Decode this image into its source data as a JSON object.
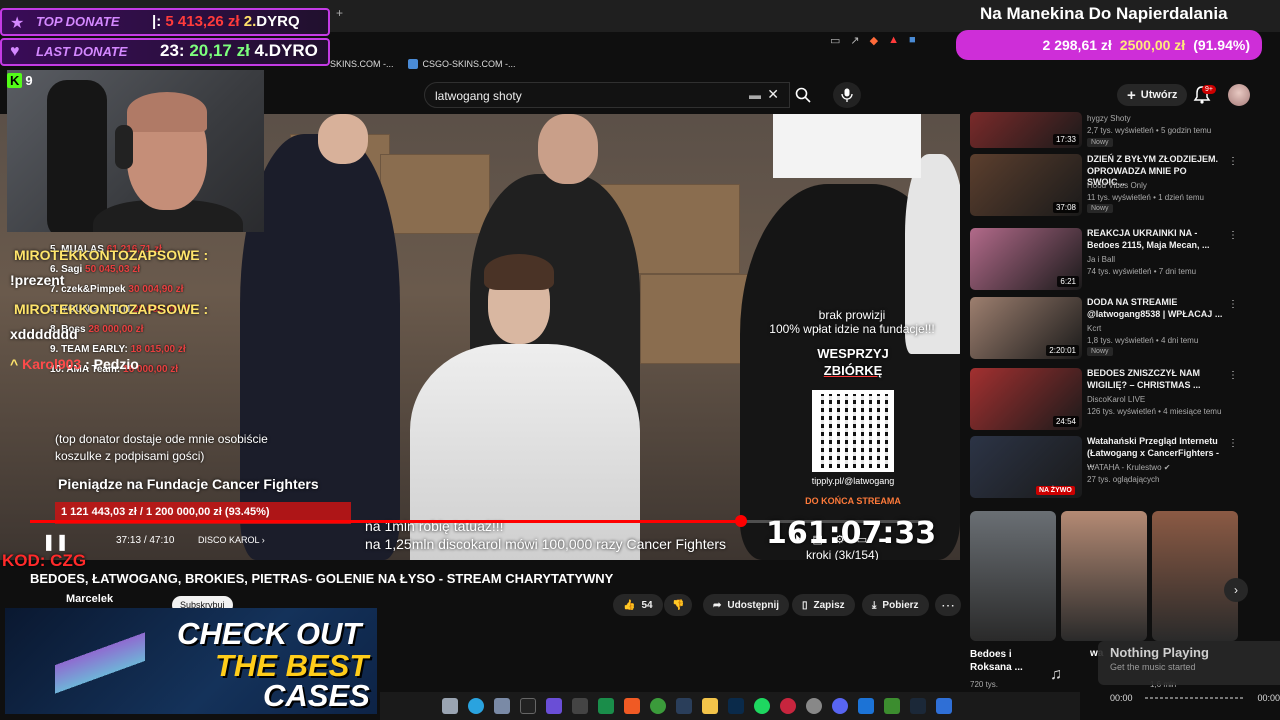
{
  "stream_overlay": {
    "top_donate_label": "TOP DONATE",
    "top_donate_amount": "5 413,26 zł",
    "top_donate_rank": "2.",
    "top_donate_name_prefix": "|:",
    "top_donate_name": "DYRQ",
    "last_donate_label": "LAST DONATE",
    "last_donate_prefix": "23:",
    "last_donate_amount": "20,17 zł",
    "last_donate_rank": "4.",
    "last_donate_name": "DYRO",
    "goal_title": "Na Manekina Do Napierdalania",
    "goal_current": "2 298,61 zł",
    "goal_target": "2500,00 zł",
    "goal_percent": "(91.94%)",
    "goal_fraction": 0.9194,
    "kick_icon": "K",
    "kick_viewers": "9",
    "chat": [
      {
        "user": "MIROTEKKONTOZAPSOWE :",
        "message": "!prezent"
      },
      {
        "user": "MIROTEKKONTOZAPSOWE :",
        "message": "xddddddd"
      },
      {
        "user": "Karol903",
        "message": ": Pedzio"
      }
    ],
    "promo_code": "KOD: CZG",
    "banner_line1": "CHECK OUT",
    "banner_line2": "THE BEST",
    "banner_line3": "CASES"
  },
  "browser": {
    "bookmarks": [
      "SKINS.COM -...",
      "CSGO-SKINS.COM -..."
    ]
  },
  "youtube": {
    "search_value": "latwogang shoty",
    "create_label": "Utwórz",
    "notifications_count": "9+",
    "video": {
      "overlay_fundraiser_1": "brak prowizji",
      "overlay_fundraiser_2": "100% wpłat idzie na fundacje!!!",
      "overlay_wesprzyj": "WESPRZYJ",
      "overlay_zbiorke": "ZBIÓRKĘ",
      "overlay_tipply": "tipply.pl/@latwogang",
      "overlay_do_konca": "DO KOŃCA STREAMA",
      "overlay_timer": "161:07:33",
      "overlay_kroki": "kroki (3k/154)",
      "overlay_1mln": "na 1mln robię tatuaż!!!",
      "overlay_125mln": "na 1,25mln discokarol mówi 100,000 razy Cancer Fighters",
      "overlay_donors": [
        {
          "rank": "5.",
          "name": "MUALAS",
          "amount": "61 216,71 zł"
        },
        {
          "rank": "6.",
          "name": "Sagi",
          "amount": "50 045,03 zł"
        },
        {
          "rank": "7.",
          "name": "czek&Pimpek",
          "amount": "30 004,90 zł"
        },
        {
          "rank": "8.",
          "name": "YOUNG MULTI",
          "amount": "28 035,00 zł"
        },
        {
          "rank": "8.",
          "name": "Boss",
          "amount": "28 000,00 zł"
        },
        {
          "rank": "9.",
          "name": "TEAM EARLY:",
          "amount": "18 015,00 zł"
        },
        {
          "rank": "10.",
          "name": "AMA Team:",
          "amount": "16 000,00 zł"
        }
      ],
      "overlay_note": "(top donator dostaje ode mnie osobiście koszulke z podpisami gości)",
      "overlay_fundacja": "Pieniądze na Fundacje Cancer Fighters",
      "overlay_redbar": "1 121 443,03 zł / 1 200 000,00 zł (93.45%)",
      "time_current": "37:13",
      "time_total": "47:10",
      "time_separator": "/",
      "progress_fraction": 0.79,
      "chapter": "DISCO KAROL",
      "title": "BEDOES, ŁATWOGANG, BROKIES, PIETRAS- GOLENIE NA ŁYSO - STREAM CHARYTATYWNY",
      "channel": "Marcelek",
      "subscribe_label": "Subskrybuj",
      "likes": "54",
      "share_label": "Udostępnij",
      "save_label": "Zapisz",
      "download_label": "Pobierz"
    },
    "recommendations": [
      {
        "title": "",
        "channel": "hygzy Shoty",
        "meta": "2,7 tys. wyświetleń • 5 godzin temu",
        "badge": "Nowy",
        "duration": "17:33",
        "thumb": "#7a2a2a"
      },
      {
        "title": "DZIEŃ Z BYŁYM ZŁODZIEJEM. OPROWADZA MNIE PO SWOIC...",
        "channel": "Hood Vibes Only",
        "meta": "11 tys. wyświetleń • 1 dzień temu",
        "badge": "Nowy",
        "duration": "37:08",
        "thumb": "#5c3f2e"
      },
      {
        "title": "REAKCJA UKRAINKI NA - Bedoes 2115, Maja Mecan, ...",
        "channel": "Ja i Ball",
        "meta": "74 tys. wyświetleń • 7 dni temu",
        "badge": "",
        "duration": "6:21",
        "thumb": "#b26a8a"
      },
      {
        "title": "DODA NA STREAMIE @latwogang8538 | WPŁACAJ ...",
        "channel": "Kcrt",
        "meta": "1,8 tys. wyświetleń • 4 dni temu",
        "badge": "Nowy",
        "duration": "2:20:01",
        "thumb": "#9d7f6f"
      },
      {
        "title": "BEDOES ZNISZCZYŁ NAM WIGILIĘ? – CHRISTMAS ...",
        "channel": "DiscoKarol LIVE",
        "meta": "126 tys. wyświetleń • 4 miesiące temu",
        "badge": "",
        "duration": "24:54",
        "thumb": "#a33030"
      },
      {
        "title": "Watahański Przegląd Internetu (Łatwogang x CancerFighters - ...",
        "channel": "WATAHA - Krulestwo ✔",
        "meta": "27 tys. oglądających",
        "badge": "",
        "duration": "",
        "live": "NA ŻYWO",
        "thumb": "#2c3446"
      }
    ],
    "shorts": [
      {
        "label": "Bedoes i Roksana ...",
        "views": "720 tys.",
        "thumb": "#6a6f74"
      },
      {
        "label": "",
        "views": "",
        "thumb": "#b48a74"
      },
      {
        "label": "",
        "views": "",
        "thumb": "#8b5a44"
      }
    ],
    "short_partial_label": "wa",
    "short_partial_views": "1,6 mln"
  },
  "now_playing": {
    "title": "Nothing Playing",
    "subtitle": "Get the music started",
    "time_left": "00:00",
    "time_right": "00:00"
  },
  "colors": {
    "accent_red": "#ff0000",
    "goal_magenta": "#ce2ed8",
    "kick_green": "#53fc18"
  }
}
